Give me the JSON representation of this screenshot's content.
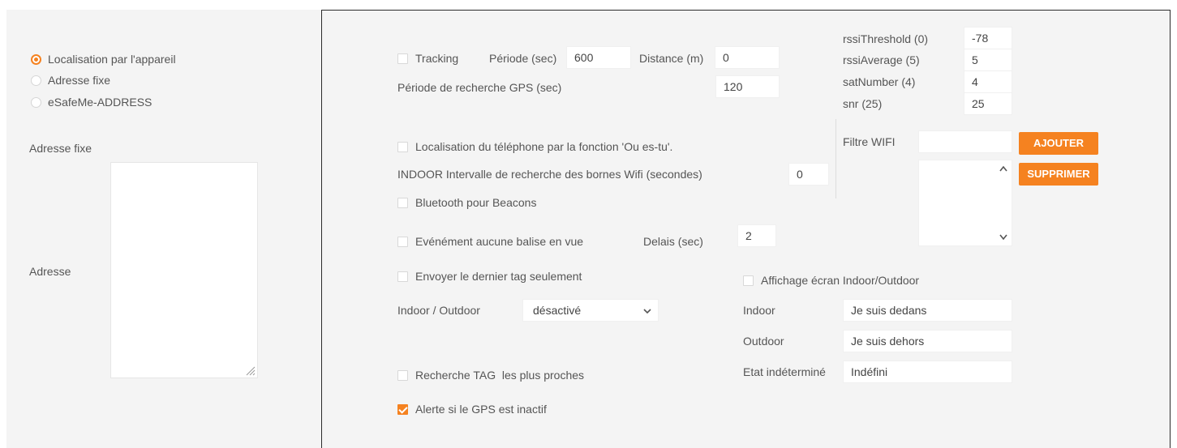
{
  "location": {
    "options": [
      {
        "label": "Localisation par l'appareil",
        "checked": true
      },
      {
        "label": "Adresse fixe",
        "checked": false
      },
      {
        "label": "eSafeMe-ADDRESS",
        "checked": false
      }
    ],
    "fixed_address_label": "Adresse fixe",
    "address_label": "Adresse"
  },
  "tracking": {
    "label": "Tracking",
    "checked": false,
    "period_label": "Période (sec)",
    "period_value": "600",
    "distance_label": "Distance (m)",
    "distance_value": "0",
    "gps_period_label": "Période de recherche GPS (sec)",
    "gps_period_value": "120"
  },
  "rssi": {
    "rows": [
      {
        "label": "rssiThreshold (0)",
        "value": "-78"
      },
      {
        "label": "rssiAverage (5)",
        "value": "5"
      },
      {
        "label": "satNumber (4)",
        "value": "4"
      },
      {
        "label": "snr (25)",
        "value": "25"
      }
    ]
  },
  "phone_location": {
    "label": "Localisation du téléphone par la fonction 'Ou es-tu'.",
    "checked": false
  },
  "indoor_wifi": {
    "label": "INDOOR Intervalle de recherche des bornes Wifi (secondes)",
    "value": "0"
  },
  "bluetooth": {
    "label": "Bluetooth pour Beacons",
    "checked": false
  },
  "no_beacon": {
    "label": "Evénément aucune balise en vue",
    "checked": false,
    "delay_label": "Delais (sec)",
    "delay_value": "2"
  },
  "last_tag": {
    "label": "Envoyer le dernier tag seulement",
    "checked": false
  },
  "indoor_outdoor": {
    "label": "Indoor / Outdoor",
    "selected": "désactivé"
  },
  "nearest_tag": {
    "label": "Recherche TAG  les plus proches",
    "checked": false
  },
  "gps_alert": {
    "label": "Alerte si le GPS est inactif",
    "checked": true
  },
  "wifi_filter": {
    "label": "Filtre WIFI",
    "input_value": "",
    "add_button": "AJOUTER",
    "remove_button": "SUPPRIMER"
  },
  "display_screen": {
    "label": "Affichage écran Indoor/Outdoor",
    "checked": false,
    "indoor_label": "Indoor",
    "indoor_value": "Je suis dedans",
    "outdoor_label": "Outdoor",
    "outdoor_value": "Je suis dehors",
    "unknown_label": "Etat indéterminé",
    "unknown_value": "Indéfini"
  },
  "colors": {
    "accent": "#f58220",
    "panel_bg": "#f4f4f4",
    "text": "#555555",
    "border_dark": "#2b2b2b"
  }
}
